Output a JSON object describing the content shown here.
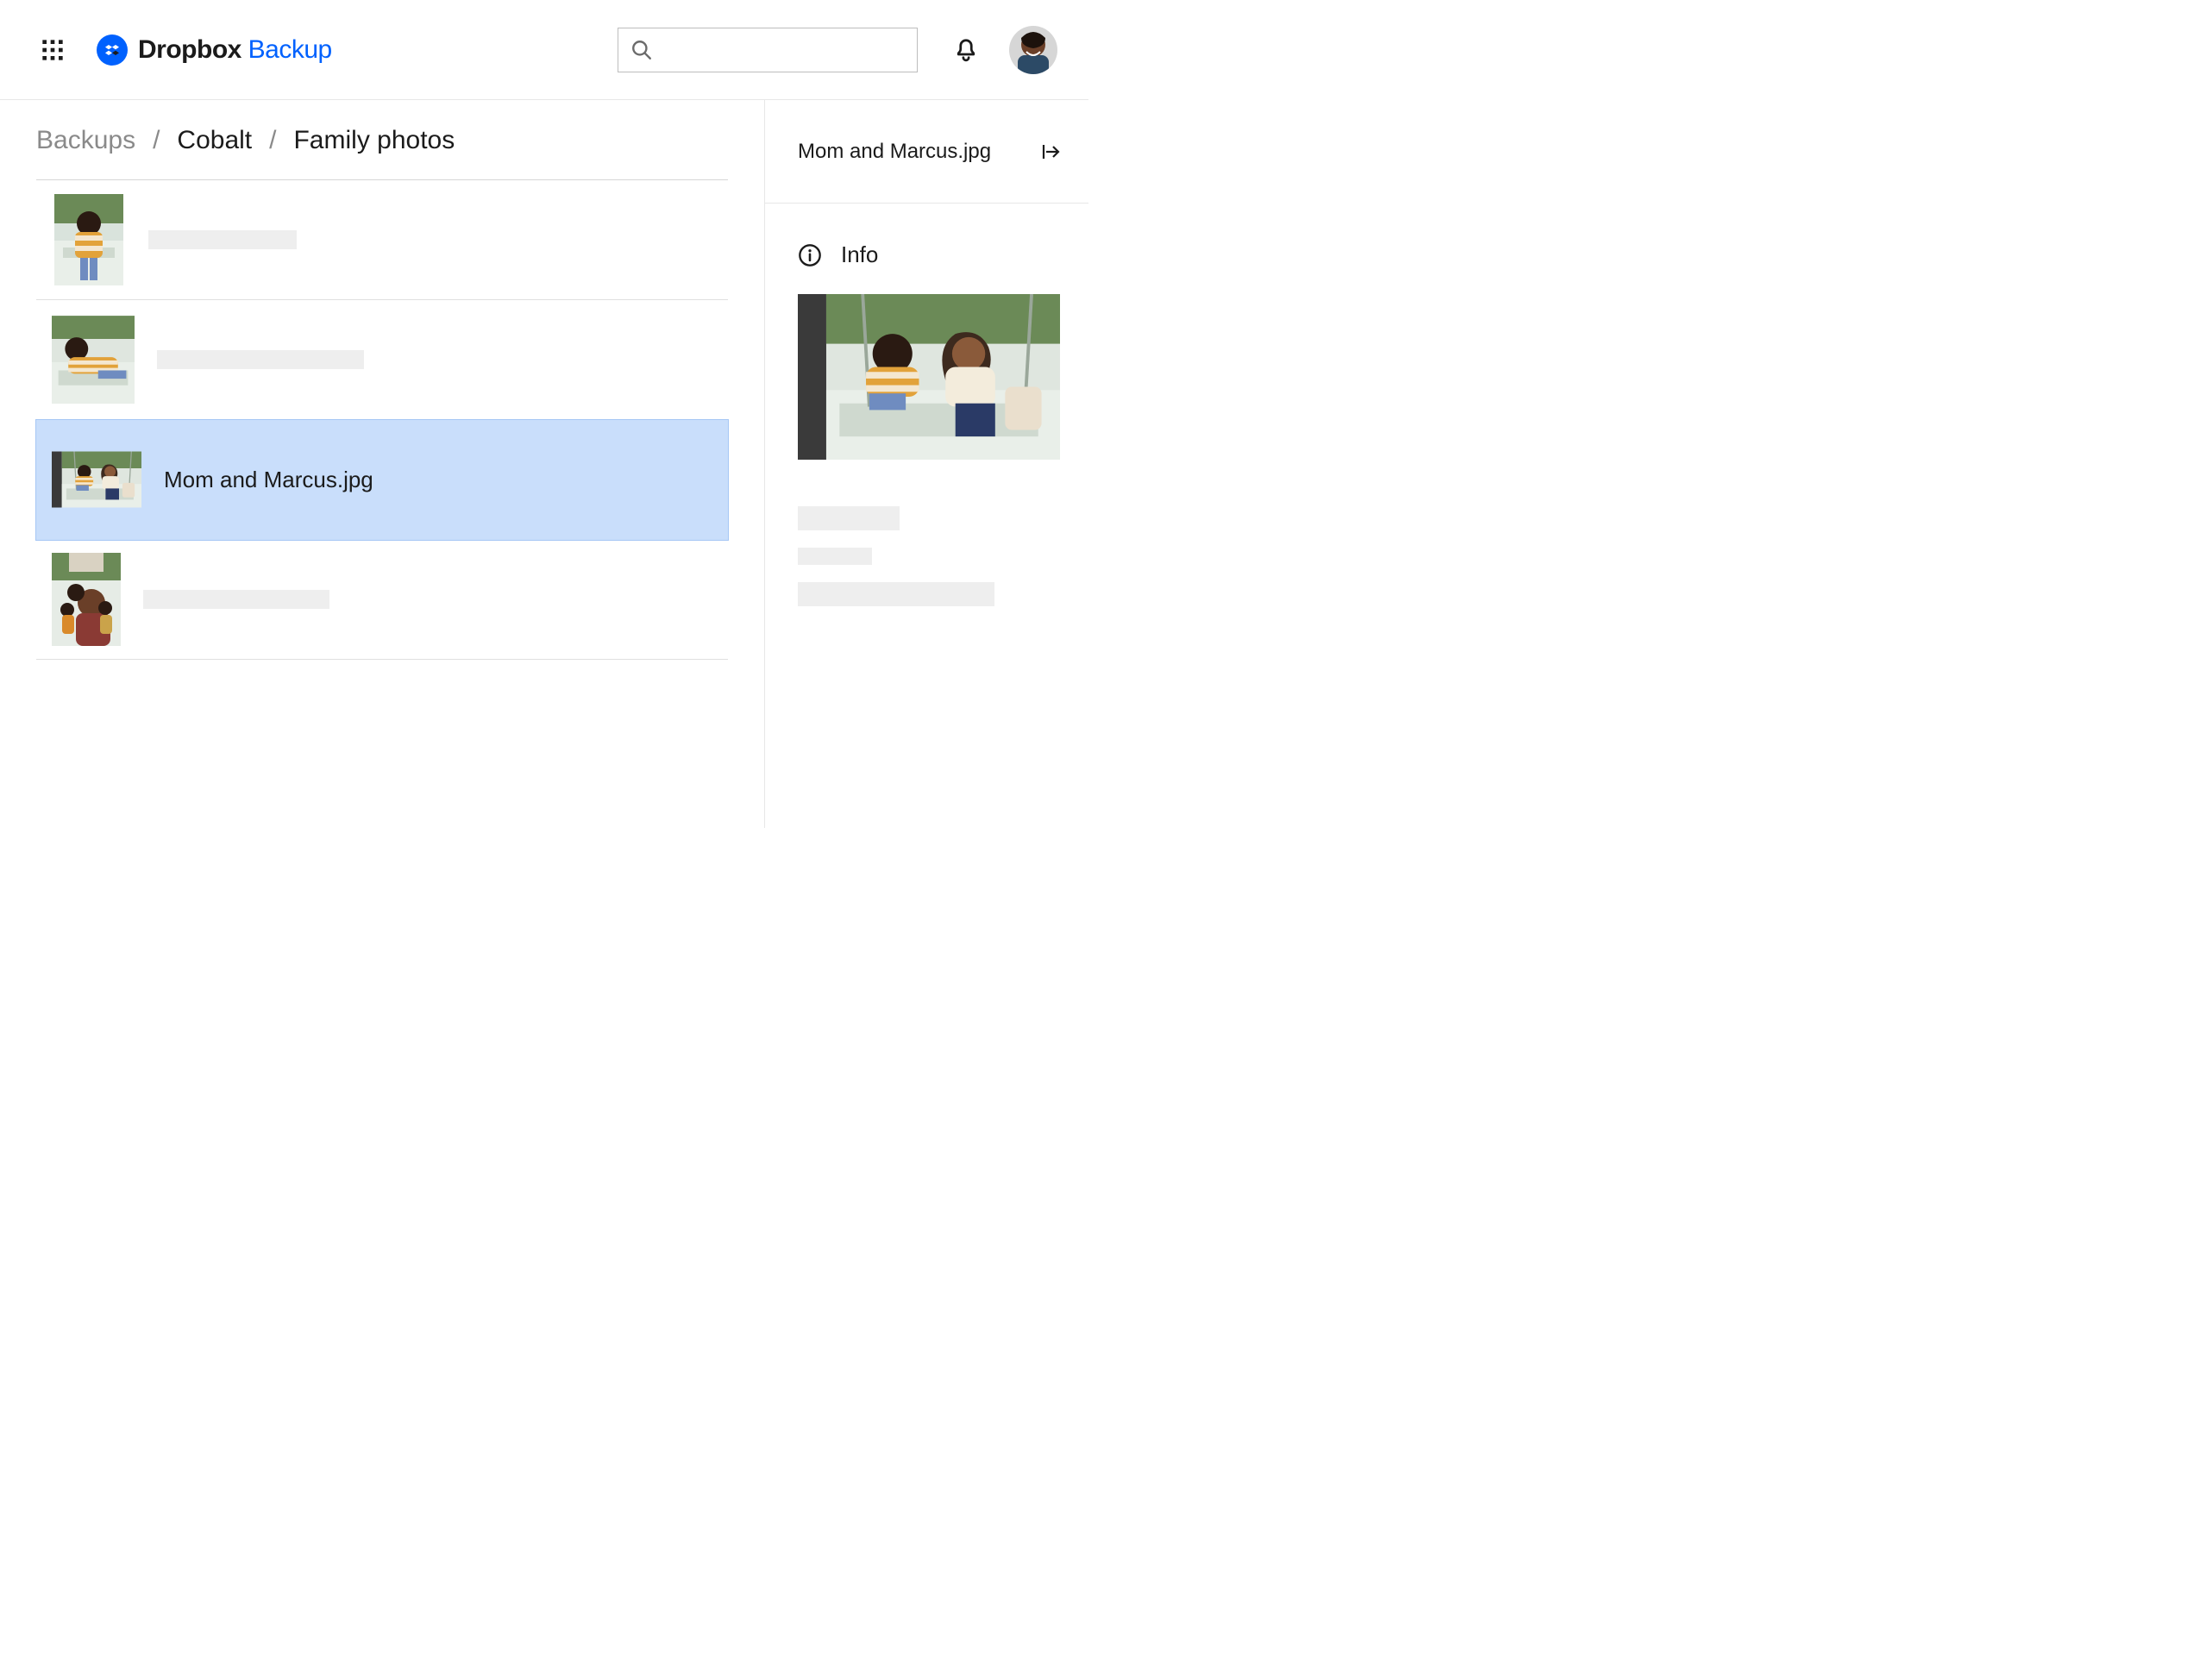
{
  "header": {
    "brand_main": "Dropbox",
    "brand_accent": "Backup",
    "search_placeholder": ""
  },
  "breadcrumb": {
    "root": "Backups",
    "mid": "Cobalt",
    "current": "Family photos"
  },
  "files": {
    "selected_index": 2,
    "selected_label": "Mom and Marcus.jpg"
  },
  "details": {
    "title": "Mom and Marcus.jpg",
    "info_label": "Info"
  }
}
